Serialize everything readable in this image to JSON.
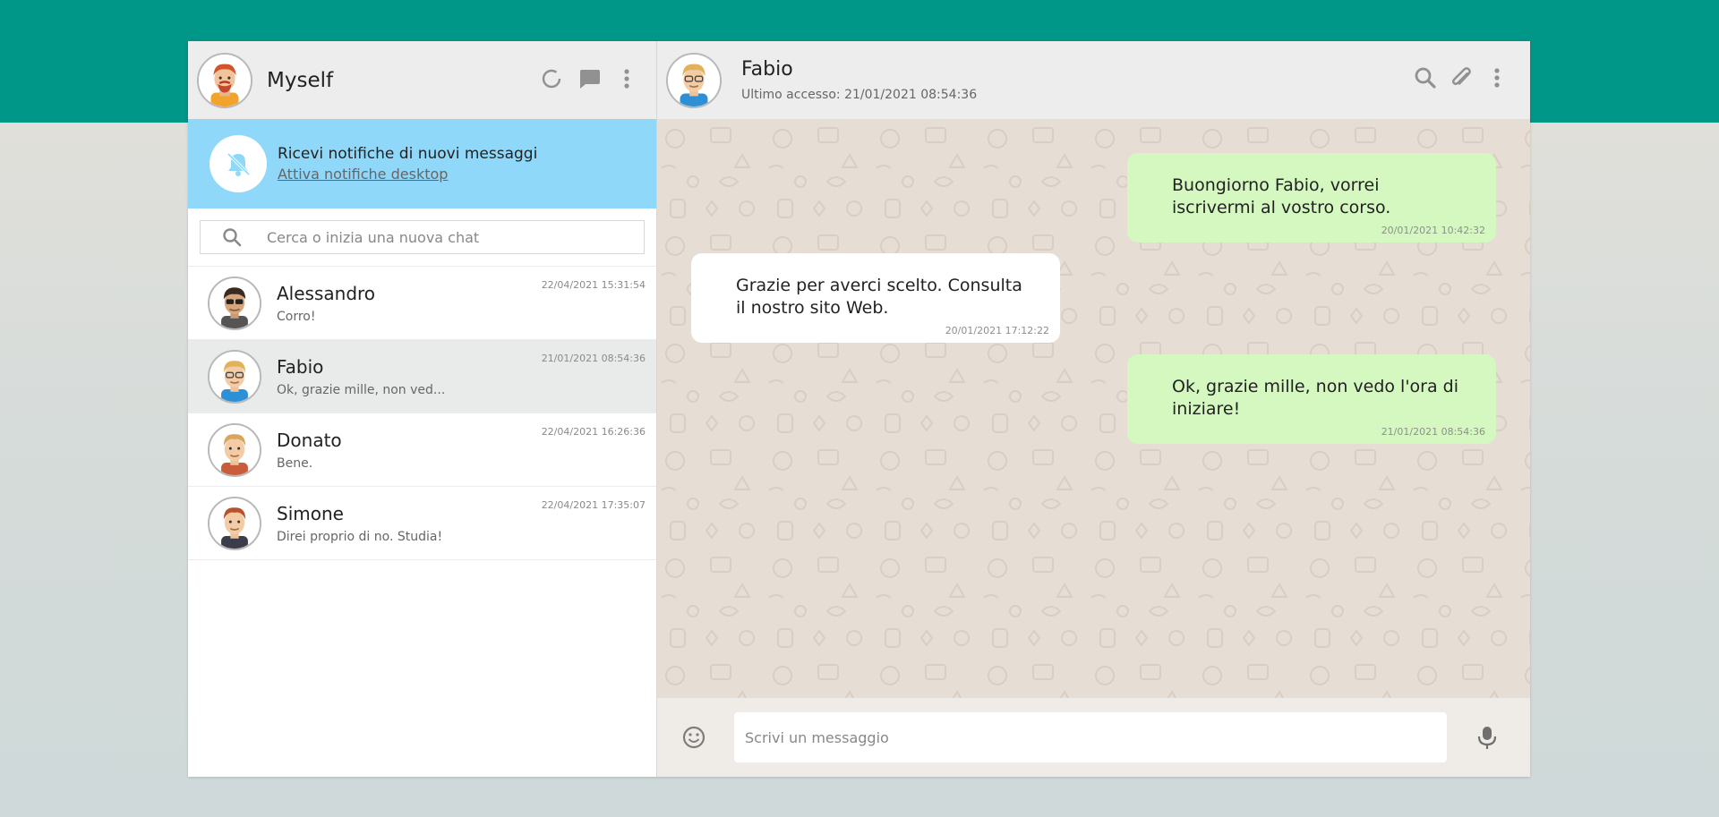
{
  "colors": {
    "brand": "#009688",
    "sent_bubble": "#d4f8c0",
    "notification": "#8fd8fa"
  },
  "sidebar": {
    "user_name": "Myself",
    "icons": [
      "status-icon",
      "new-chat-icon",
      "menu-icon"
    ],
    "notification": {
      "title": "Ricevi notifiche di nuovi messaggi",
      "link": "Attiva notifiche desktop"
    },
    "search": {
      "placeholder": "Cerca o inizia una nuova chat"
    },
    "contacts": [
      {
        "name": "Alessandro",
        "last_message": "Corro!",
        "time": "22/04/2021 15:31:54"
      },
      {
        "name": "Fabio",
        "last_message": "Ok, grazie mille, non ved...",
        "time": "21/01/2021 08:54:36",
        "active": true
      },
      {
        "name": "Donato",
        "last_message": "Bene.",
        "time": "22/04/2021 16:26:36"
      },
      {
        "name": "Simone",
        "last_message": "Direi proprio di no. Studia!",
        "time": "22/04/2021 17:35:07"
      }
    ]
  },
  "chat": {
    "name": "Fabio",
    "status": "Ultimo accesso: 21/01/2021 08:54:36",
    "icons": [
      "search-icon",
      "attach-icon",
      "menu-icon"
    ],
    "messages": [
      {
        "direction": "sent",
        "line1": "Buongiorno Fabio, vorrei",
        "line2": "iscrivermi al vostro corso.",
        "time": "20/01/2021 10:42:32"
      },
      {
        "direction": "received",
        "line1": "Grazie per averci scelto. Consulta",
        "line2": "il nostro sito Web.",
        "time": "20/01/2021 17:12:22"
      },
      {
        "direction": "sent",
        "line1": "Ok, grazie mille, non vedo l'ora di",
        "line2": "iniziare!",
        "time": "21/01/2021 08:54:36"
      }
    ],
    "composer": {
      "placeholder": "Scrivi un messaggio"
    }
  }
}
